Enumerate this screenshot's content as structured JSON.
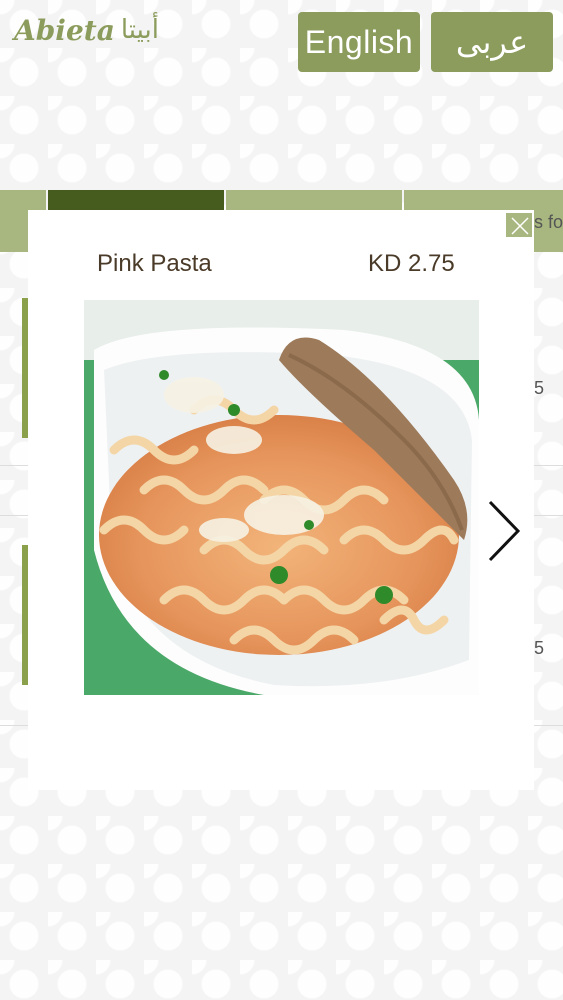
{
  "header": {
    "logo_latin": "Abieta",
    "logo_arabic": "أبيتا",
    "lang_english": "English",
    "lang_arabic": "عربى"
  },
  "background": {
    "tab_partial_text": "s fo",
    "row_prices": [
      "5",
      "5"
    ]
  },
  "modal": {
    "item_name": "Pink Pasta",
    "item_price": "KD 2.75",
    "photo_icon": "pasta-photo",
    "close_icon": "close-icon",
    "next_icon": "chevron-right-icon"
  },
  "colors": {
    "brand": "#8b9c5c",
    "tab_active": "#465c1f",
    "tab_inactive": "#a8b780",
    "text": "#4a3a28"
  }
}
